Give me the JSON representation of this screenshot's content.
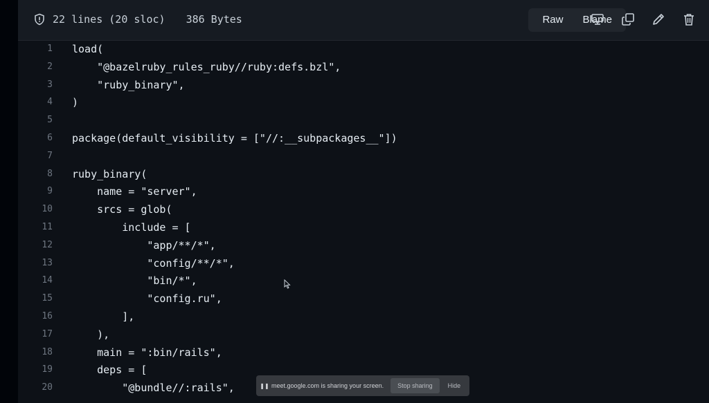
{
  "file_header": {
    "lines_info": "22 lines (20 sloc)",
    "size": "386 Bytes",
    "raw_label": "Raw",
    "blame_label": "Blame"
  },
  "icons": {
    "shield": "shield-icon",
    "desktop": "desktop-icon",
    "copy": "copy-icon",
    "edit": "pencil-icon",
    "delete": "trash-icon"
  },
  "code": {
    "lines": [
      {
        "n": "1",
        "text": "load("
      },
      {
        "n": "2",
        "text": "    \"@bazelruby_rules_ruby//ruby:defs.bzl\","
      },
      {
        "n": "3",
        "text": "    \"ruby_binary\","
      },
      {
        "n": "4",
        "text": ")"
      },
      {
        "n": "5",
        "text": ""
      },
      {
        "n": "6",
        "text": "package(default_visibility = [\"//:__subpackages__\"])"
      },
      {
        "n": "7",
        "text": ""
      },
      {
        "n": "8",
        "text": "ruby_binary("
      },
      {
        "n": "9",
        "text": "    name = \"server\","
      },
      {
        "n": "10",
        "text": "    srcs = glob("
      },
      {
        "n": "11",
        "text": "        include = ["
      },
      {
        "n": "12",
        "text": "            \"app/**/*\","
      },
      {
        "n": "13",
        "text": "            \"config/**/*\","
      },
      {
        "n": "14",
        "text": "            \"bin/*\","
      },
      {
        "n": "15",
        "text": "            \"config.ru\","
      },
      {
        "n": "16",
        "text": "        ],"
      },
      {
        "n": "17",
        "text": "    ),"
      },
      {
        "n": "18",
        "text": "    main = \":bin/rails\","
      },
      {
        "n": "19",
        "text": "    deps = ["
      },
      {
        "n": "20",
        "text": "        \"@bundle//:rails\","
      }
    ]
  },
  "screen_share": {
    "pause_icon": "pause-icon",
    "message": "meet.google.com is sharing your screen.",
    "stop_label": "Stop sharing",
    "hide_label": "Hide"
  }
}
